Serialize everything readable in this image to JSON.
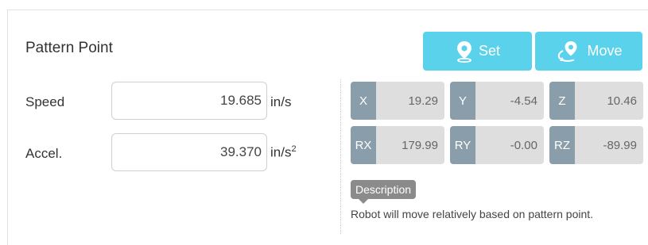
{
  "panel": {
    "title": "Pattern Point"
  },
  "buttons": {
    "set_label": "Set",
    "move_label": "Move"
  },
  "fields": {
    "speed": {
      "label": "Speed",
      "value": "19.685",
      "unit": "in/s"
    },
    "accel": {
      "label": "Accel.",
      "value": "39.370",
      "unit_base": "in/s",
      "unit_exp": "2"
    }
  },
  "pose": {
    "x": {
      "key": "X",
      "value": "19.29"
    },
    "y": {
      "key": "Y",
      "value": "-4.54"
    },
    "z": {
      "key": "Z",
      "value": "10.46"
    },
    "rx": {
      "key": "RX",
      "value": "179.99"
    },
    "ry": {
      "key": "RY",
      "value": "-0.00"
    },
    "rz": {
      "key": "RZ",
      "value": "-89.99"
    }
  },
  "description": {
    "tag": "Description",
    "text": "Robot will move relatively based on pattern point."
  },
  "colors": {
    "accent": "#5ad2ec",
    "key_bg": "#8a9daa",
    "value_bg": "#dedede"
  },
  "icons": {
    "set": "location-pin-icon",
    "move": "move-to-location-icon"
  }
}
